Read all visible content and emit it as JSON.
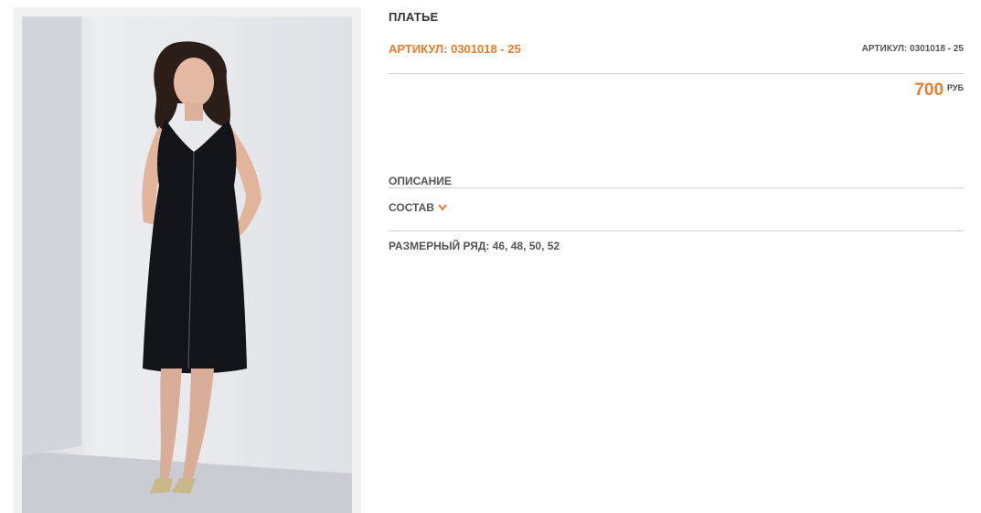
{
  "product": {
    "title": "ПЛАТЬЕ",
    "sku_main": "АРТИКУЛ: 0301018 - 25",
    "sku_small": "АРТИКУЛ: 0301018 - 25",
    "price": "700",
    "currency": "РУБ"
  },
  "sections": {
    "description_label": "ОПИСАНИЕ",
    "composition_label": "СОСТАВ",
    "sizes_label": "РАЗМЕРНЫЙ РЯД: 46, 48, 50, 52"
  },
  "colors": {
    "accent": "#ec7b2c",
    "text": "#444444",
    "rule": "#cfcfcf"
  },
  "icons": {
    "composition_toggle": "chevron-down-icon"
  }
}
